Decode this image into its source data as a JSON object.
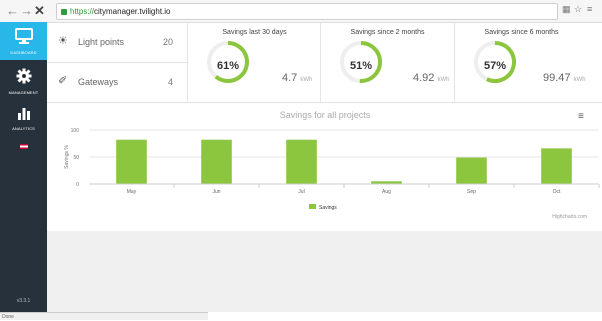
{
  "browser": {
    "back_icon": "arrow-left-icon",
    "url_scheme": "https://",
    "url_host": "citymanager.tvilight.io"
  },
  "sidebar": {
    "items": [
      {
        "label": "DASHBOARD",
        "icon": "monitor-icon",
        "active": true
      },
      {
        "label": "MANAGEMENT",
        "icon": "gear-icon",
        "active": false
      },
      {
        "label": "ANALYTICS",
        "icon": "bar-chart-icon",
        "active": false
      }
    ],
    "version": "v3.3.1",
    "active_color": "#29b6e8",
    "bg_color": "#27313c"
  },
  "stats": [
    {
      "name": "Light points",
      "value": "20",
      "icon": "sun-icon"
    },
    {
      "name": "Gateways",
      "value": "4",
      "icon": "gateway-icon"
    }
  ],
  "savings": [
    {
      "title": "Savings last 30 days",
      "percent": "61%",
      "fraction": 0.61,
      "kwh": "4.7",
      "unit": "kWh"
    },
    {
      "title": "Savings since 2 months",
      "percent": "51%",
      "fraction": 0.51,
      "kwh": "4.92",
      "unit": "kWh"
    },
    {
      "title": "Savings since 6 months",
      "percent": "57%",
      "fraction": 0.57,
      "kwh": "99.47",
      "unit": "kWh"
    }
  ],
  "status_bar": "Done",
  "chart_data": {
    "type": "bar",
    "title": "Savings for all projects",
    "ylabel": "Savings %",
    "ylim": [
      0,
      100
    ],
    "yticks": [
      "100",
      "50",
      "0"
    ],
    "categories": [
      "May",
      "Jun",
      "Jul",
      "Aug",
      "Sep",
      "Oct"
    ],
    "series": [
      {
        "name": "Savings",
        "values": [
          82,
          82,
          82,
          5,
          49,
          66
        ]
      }
    ],
    "color": "#8cc63f",
    "credit": "Highcharts.com",
    "grid": true,
    "legend_position": "bottom-center"
  }
}
